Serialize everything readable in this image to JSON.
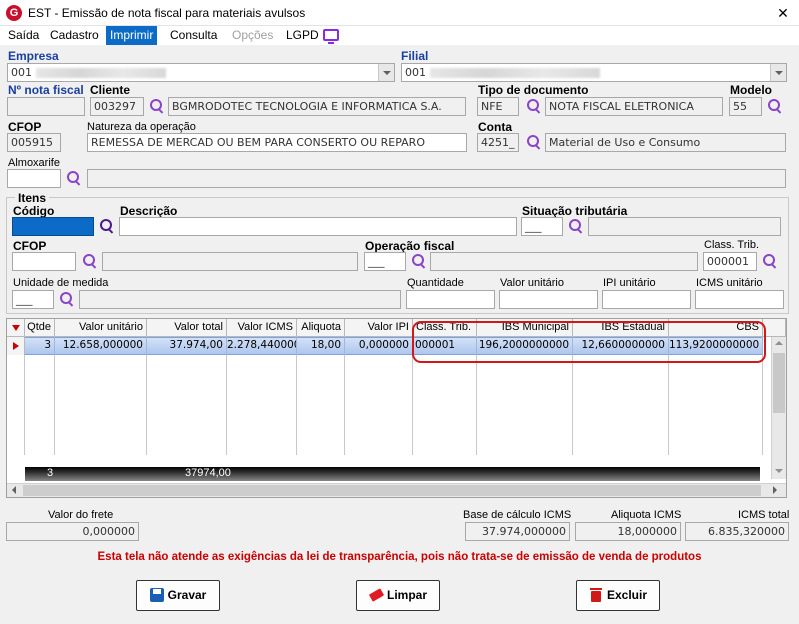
{
  "window": {
    "title": "EST - Emissão de nota fiscal para materiais avulsos",
    "icon_letter": "G",
    "close_glyph": "✕"
  },
  "menu": {
    "saida": "Saída",
    "cadastro": "Cadastro",
    "imprimir": "Imprimir",
    "consulta": "Consulta",
    "opcoes": "Opções",
    "lgpd": "LGPD"
  },
  "header": {
    "empresa_label": "Empresa",
    "empresa_value": "001",
    "filial_label": "Filial",
    "filial_value": "001",
    "nf_label": "Nº nota fiscal",
    "nf_value": "",
    "cliente_label": "Cliente",
    "cliente_code": "003297",
    "cliente_name": "BGMRODOTEC TECNOLOGIA E INFORMATICA S.A.",
    "tipo_doc_label": "Tipo de documento",
    "tipo_doc_code": "NFE",
    "tipo_doc_name": "NOTA FISCAL ELETRONICA",
    "modelo_label": "Modelo",
    "modelo_value": "55",
    "cfop_label": "CFOP",
    "cfop_value": "005915",
    "natureza_label": "Natureza da operação",
    "natureza_value": "REMESSA DE MERCAD OU BEM PARA CONSERTO OU REPARO",
    "conta_label": "Conta",
    "conta_code": "4251_",
    "conta_name": "Material de Uso e Consumo",
    "almox_label": "Almoxarife",
    "almox_value": ""
  },
  "itens": {
    "group_label": "Itens",
    "codigo_label": "Código",
    "descricao_label": "Descrição",
    "situacao_label": "Situação tributária",
    "situacao_value": "___",
    "cfop_label": "CFOP",
    "operacao_label": "Operação fiscal",
    "operacao_value": "___",
    "class_trib_label": "Class. Trib.",
    "class_trib_value": "000001",
    "unidade_label": "Unidade de medida",
    "unidade_value": "___",
    "quantidade_label": "Quantidade",
    "valor_unit_label": "Valor unitário",
    "ipi_unit_label": "IPI unitário",
    "icms_unit_label": "ICMS unitário"
  },
  "grid": {
    "columns": [
      "Qtde",
      "Valor unitário",
      "Valor total",
      "Valor ICMS",
      "Aliquota",
      "Valor IPI",
      "Class. Trib.",
      "IBS Municipal",
      "IBS Estadual",
      "CBS"
    ],
    "rows": [
      [
        "3",
        "12.658,000000",
        "37.974,00",
        "2.278,440000",
        "18,00",
        "0,000000",
        "000001",
        "196,2000000000",
        "12,6600000000",
        "113,9200000000"
      ]
    ],
    "totals": {
      "qtde": "3",
      "valor_total": "37974,00"
    }
  },
  "footer": {
    "frete_label": "Valor do frete",
    "frete_value": "0,000000",
    "base_icms_label": "Base de cálculo ICMS",
    "base_icms_value": "37.974,000000",
    "aliquota_icms_label": "Aliquota ICMS",
    "aliquota_icms_value": "18,000000",
    "icms_total_label": "ICMS total",
    "icms_total_value": "6.835,320000",
    "warning": "Esta tela não atende as exigências da lei de transparência, pois não trata-se de emissão de venda de produtos"
  },
  "buttons": {
    "gravar": "Gravar",
    "limpar": "Limpar",
    "excluir": "Excluir"
  },
  "colors": {
    "accent": "#0b6bc6",
    "label_blue": "#1a3fa0",
    "warning_red": "#cc0000",
    "highlight_red": "#d01818",
    "selected_row": "#b9cef0"
  }
}
